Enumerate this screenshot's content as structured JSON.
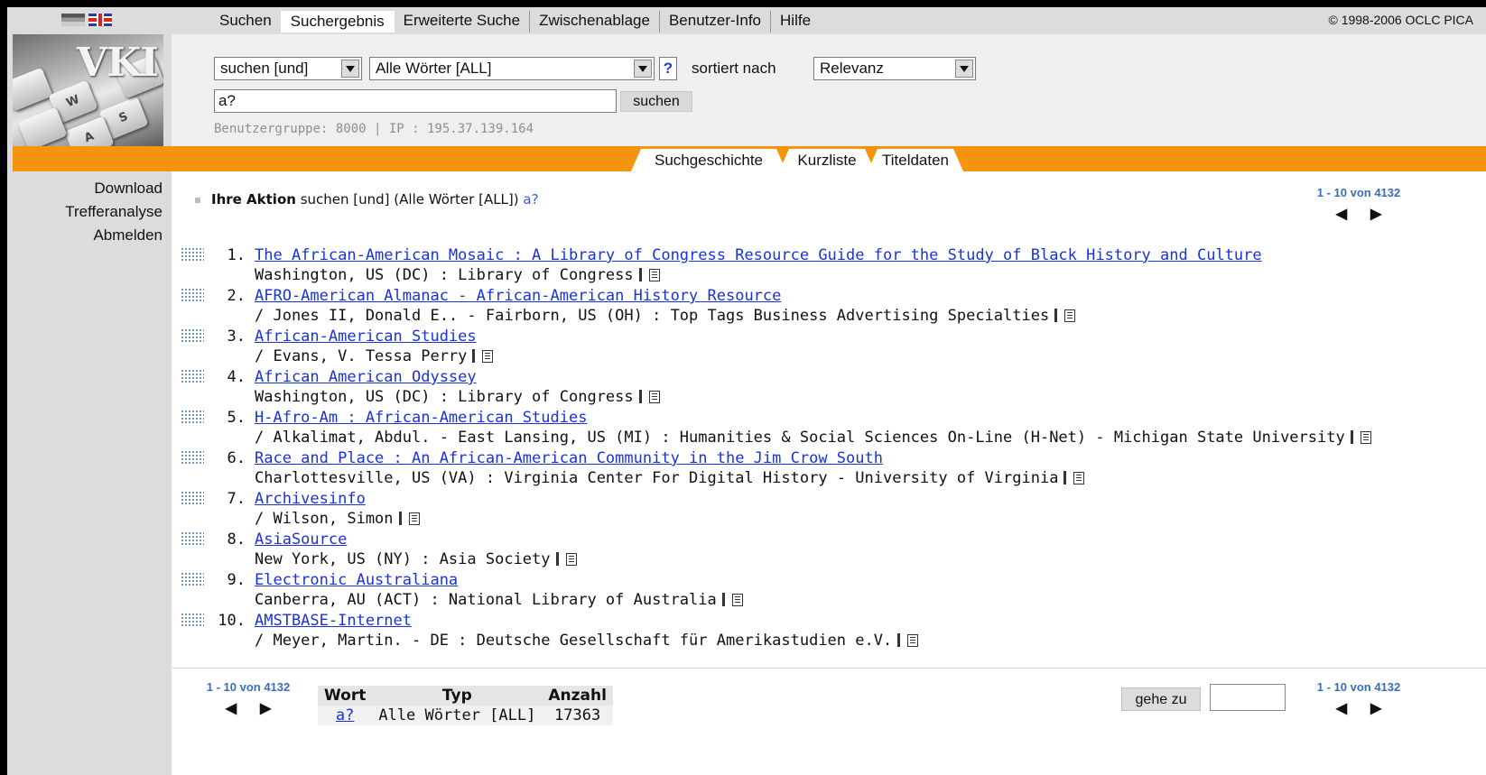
{
  "nav": {
    "tabs": [
      "Suchen",
      "Suchergebnis",
      "Erweiterte Suche",
      "Zwischenablage",
      "Benutzer-Info",
      "Hilfe"
    ],
    "active_tab": "Suchergebnis",
    "copyright": "© 1998-2006 OCLC PICA"
  },
  "logo": {
    "text": "VKI"
  },
  "search": {
    "operator": "suchen [und]",
    "field": "Alle Wörter [ALL]",
    "help": "?",
    "sort_label": "sortiert nach",
    "sort_value": "Relevanz",
    "query": "a?",
    "submit_label": "suchen",
    "user_info": "Benutzergruppe: 8000 | IP : 195.37.139.164"
  },
  "view_tabs": [
    "Suchgeschichte",
    "Kurzliste",
    "Titeldaten"
  ],
  "sidebar": {
    "items": [
      "Download",
      "Trefferanalyse",
      "Abmelden"
    ]
  },
  "action": {
    "label": "Ihre Aktion",
    "text": "suchen [und] (Alle Wörter [ALL])",
    "query_link": "a?"
  },
  "pager": {
    "text": "1 - 10 von 4132",
    "prev": "◀",
    "next": "▶"
  },
  "results": [
    {
      "num": "1.",
      "title": "The African-American Mosaic : A Library of Congress Resource Guide for the Study of Black History and Culture",
      "info": "Washington, US (DC) : Library of Congress"
    },
    {
      "num": "2.",
      "title": "AFRO-American Almanac - African-American History Resource",
      "info": "/ Jones II, Donald E.. - Fairborn, US (OH) : Top Tags Business Advertising Specialties"
    },
    {
      "num": "3.",
      "title": "African-American Studies",
      "info": "/ Evans, V. Tessa Perry"
    },
    {
      "num": "4.",
      "title": "African American Odyssey",
      "info": "Washington, US (DC) : Library of Congress"
    },
    {
      "num": "5.",
      "title": "H-Afro-Am : African-American Studies",
      "info": "/ Alkalimat, Abdul. - East Lansing, US (MI) : Humanities & Social Sciences On-Line (H-Net) - Michigan State University"
    },
    {
      "num": "6.",
      "title": "Race and Place : An African-American Community in the Jim Crow South",
      "info": "Charlottesville, US (VA) : Virginia Center For Digital History - University of Virginia"
    },
    {
      "num": "7.",
      "title": "Archivesinfo",
      "info": "/ Wilson, Simon"
    },
    {
      "num": "8.",
      "title": "AsiaSource",
      "info": "New York, US (NY) : Asia Society"
    },
    {
      "num": "9.",
      "title": "Electronic Australiana",
      "info": "Canberra, AU (ACT) : National Library of Australia"
    },
    {
      "num": "10.",
      "title": "AMSTBASE-Internet",
      "info": "/ Meyer, Martin. - DE : Deutsche Gesellschaft für Amerikastudien e.V."
    }
  ],
  "word_table": {
    "headers": [
      "Wort",
      "Typ",
      "Anzahl"
    ],
    "row": [
      "a?",
      "Alle Wörter [ALL]",
      "17363"
    ]
  },
  "goto": {
    "label": "gehe zu",
    "value": ""
  }
}
